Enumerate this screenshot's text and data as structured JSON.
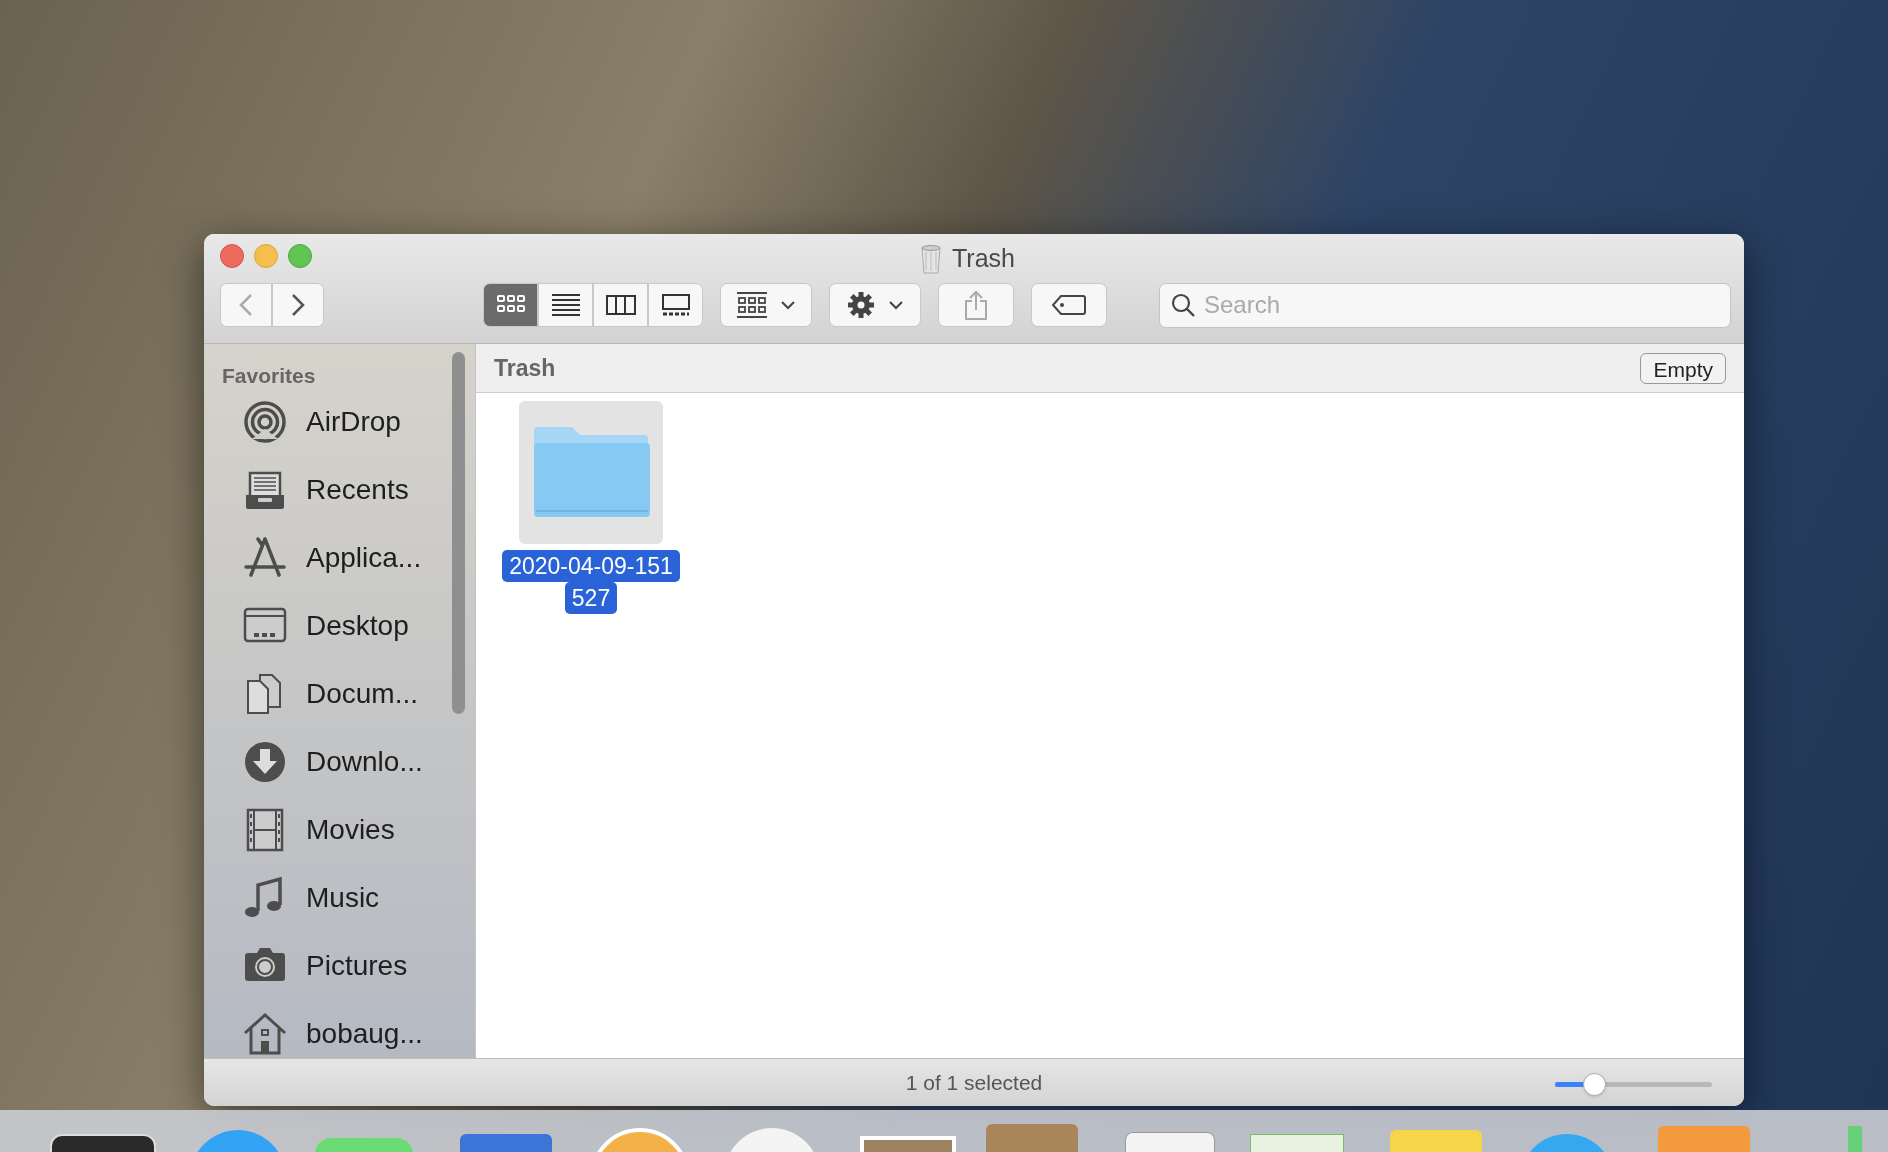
{
  "window": {
    "title": "Trash"
  },
  "toolbar": {
    "view_modes": [
      {
        "kind": "icons",
        "selected": true
      },
      {
        "kind": "list",
        "selected": false
      },
      {
        "kind": "columns",
        "selected": false
      },
      {
        "kind": "gallery",
        "selected": false
      }
    ],
    "search": {
      "placeholder": "Search"
    }
  },
  "sidebar": {
    "heading": "Favorites",
    "items": [
      {
        "label": "AirDrop",
        "kind": "airdrop"
      },
      {
        "label": "Recents",
        "kind": "recents"
      },
      {
        "label": "Applica...",
        "kind": "applications"
      },
      {
        "label": "Desktop",
        "kind": "desktop"
      },
      {
        "label": "Docum...",
        "kind": "documents"
      },
      {
        "label": "Downlo...",
        "kind": "downloads"
      },
      {
        "label": "Movies",
        "kind": "movies"
      },
      {
        "label": "Music",
        "kind": "music"
      },
      {
        "label": "Pictures",
        "kind": "pictures"
      },
      {
        "label": "bobaug...",
        "kind": "home"
      }
    ]
  },
  "path_bar": {
    "title": "Trash",
    "button": "Empty"
  },
  "files": [
    {
      "name_lines": [
        "2020-04-09-151",
        "527"
      ],
      "selected": true
    }
  ],
  "status_bar": {
    "text": "1 of 1 selected",
    "zoom_slider": {
      "level": 0.25
    }
  }
}
